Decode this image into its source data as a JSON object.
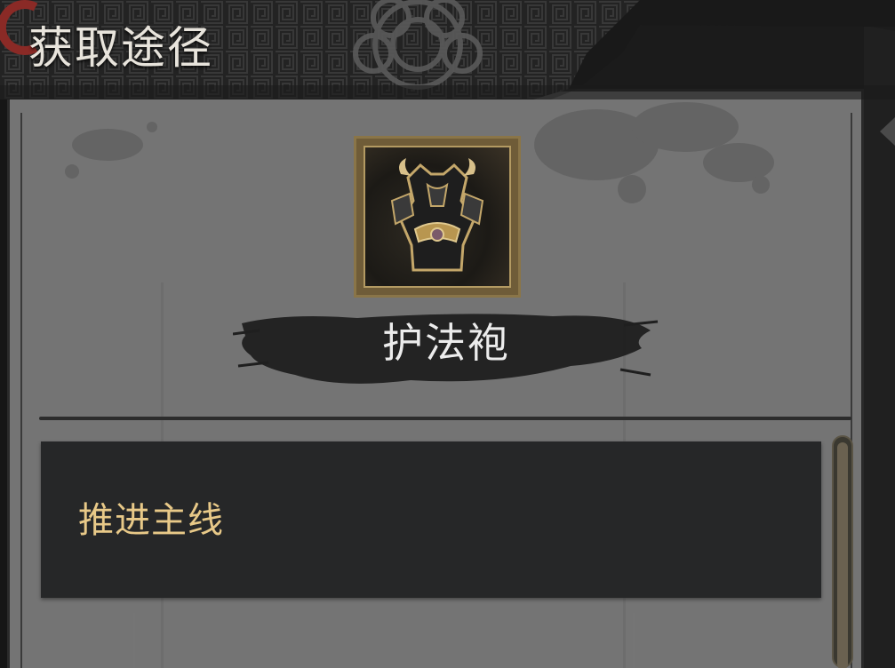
{
  "header": {
    "title": "获取途径",
    "ornament_icon": "ring-icon"
  },
  "item": {
    "name": "护法袍",
    "icon": "armor-robe-icon",
    "frame_color": "#8a7548"
  },
  "sources": [
    {
      "label": "推进主线"
    }
  ],
  "colors": {
    "panel": "#747474",
    "source_bg": "#262728",
    "source_text": "#e8c988",
    "title_text": "#e8e4dc",
    "name_text": "#ececec"
  }
}
